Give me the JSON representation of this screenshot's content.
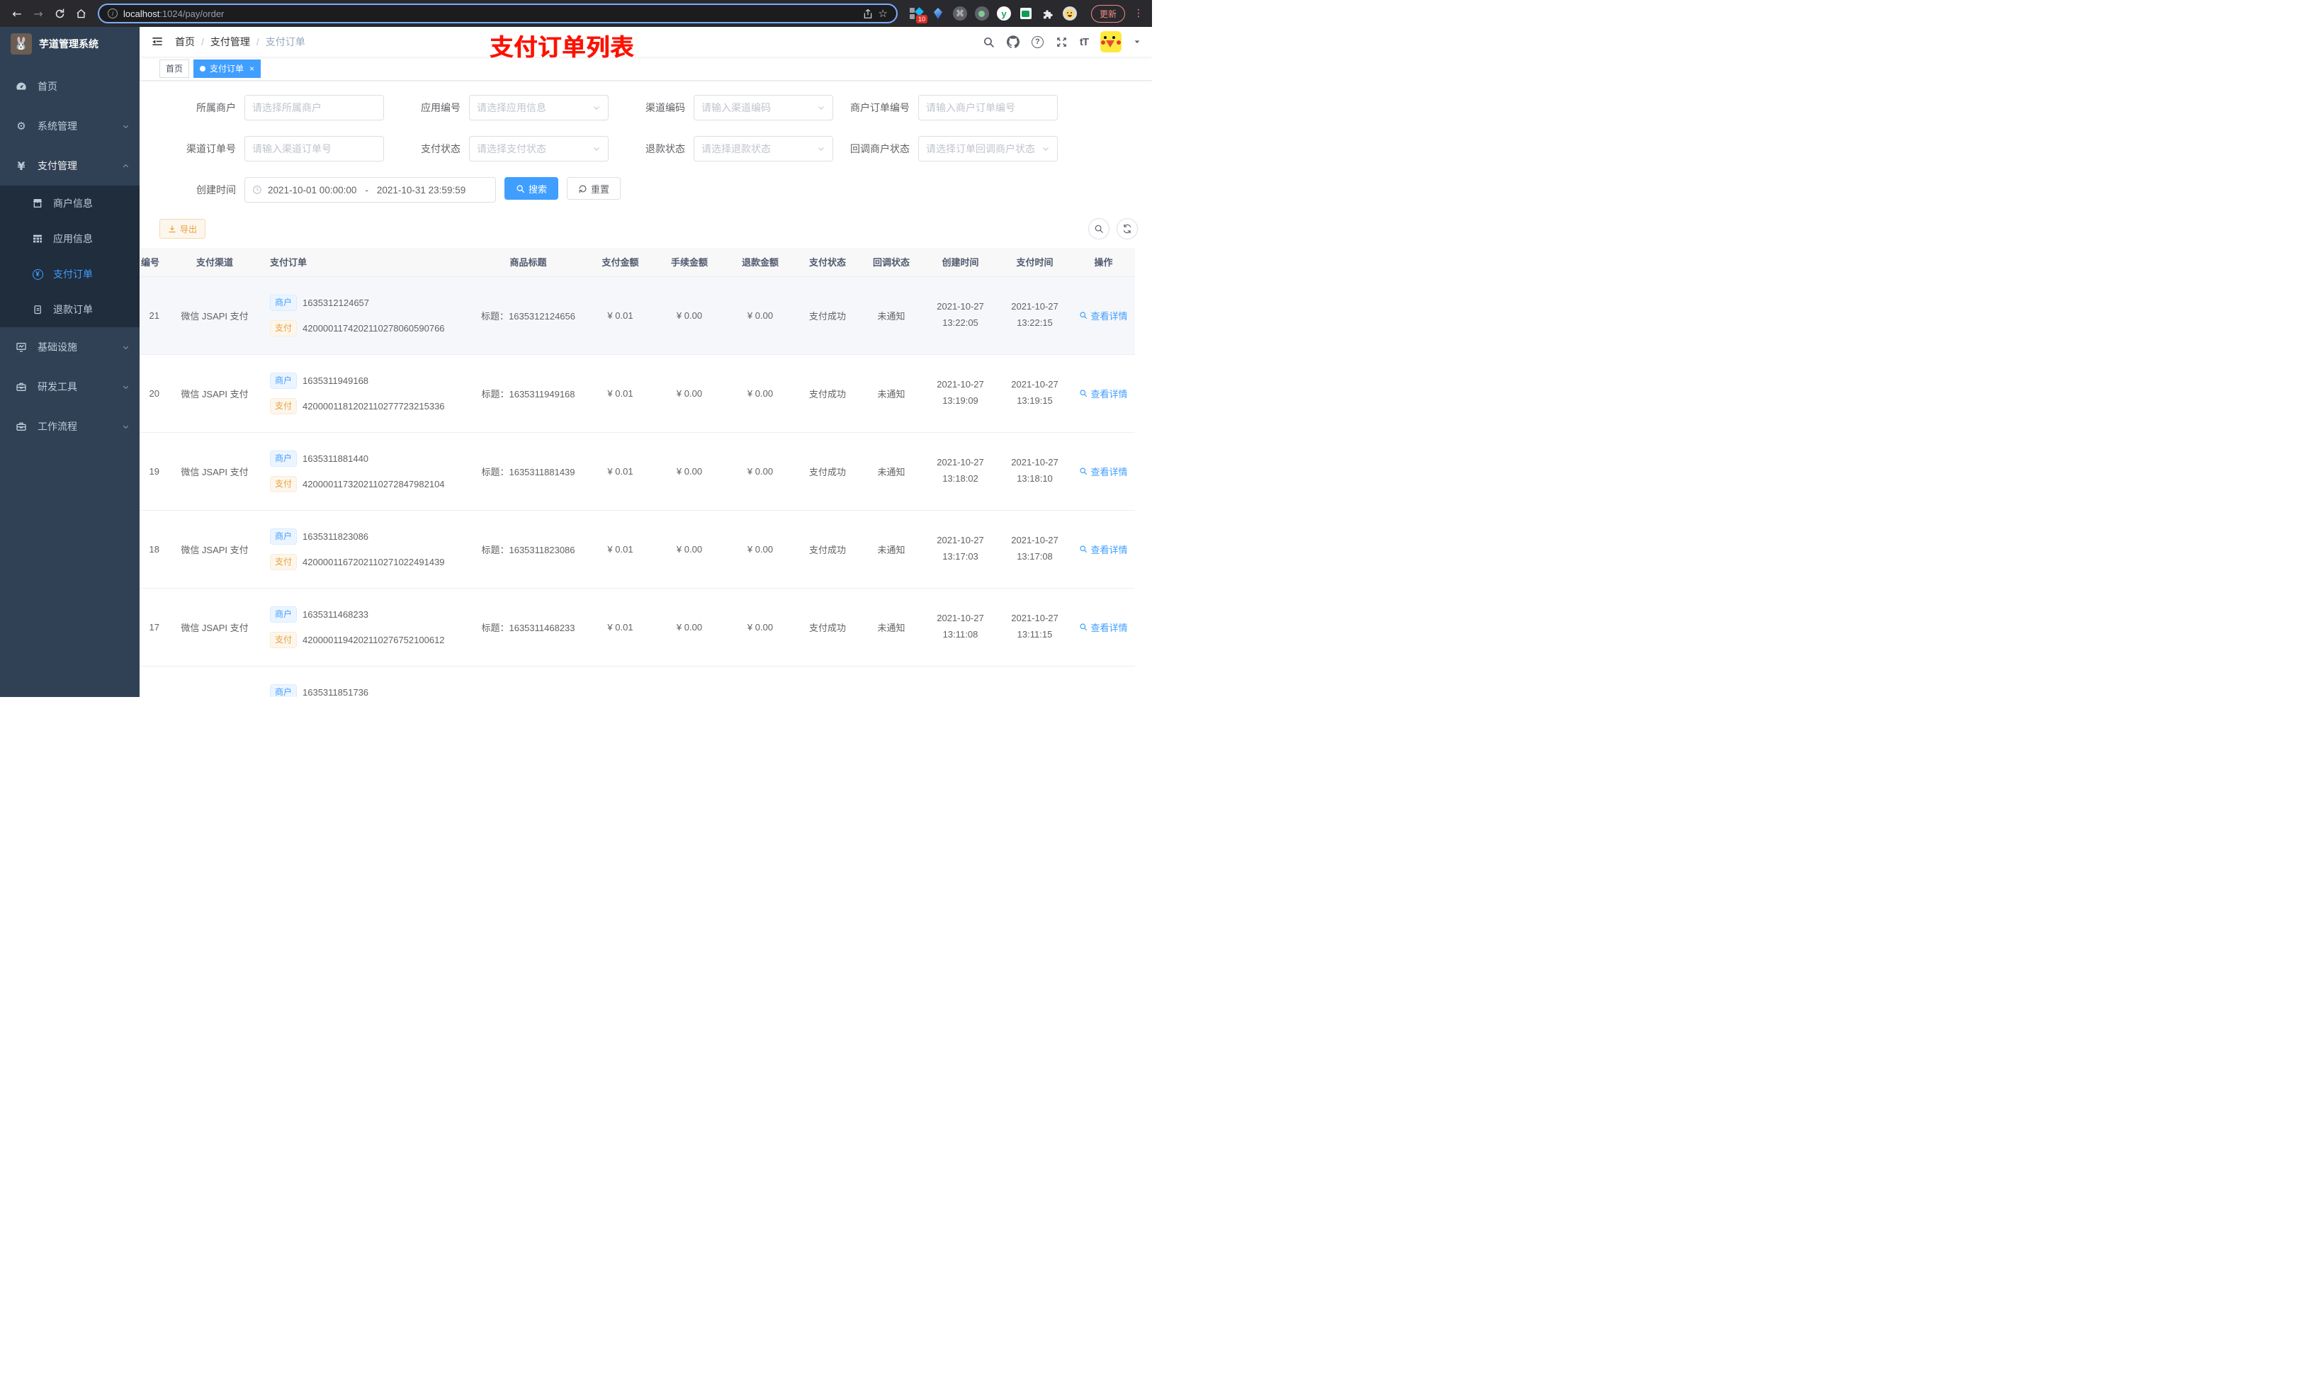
{
  "colors": {
    "primary": "#409eff",
    "warning": "#e6a23c",
    "sidebar_bg": "#304156",
    "submenu_bg": "#1f2d3d",
    "annotation_red": "#fe1100",
    "chrome_bg": "#2a2a2e"
  },
  "browser": {
    "url_host": "localhost",
    "url_path": ":1024/pay/order",
    "info_glyph": "i",
    "ext_badge": "10",
    "ext_y_glyph": "y",
    "cmd_glyph": "⌘",
    "update_label": "更新",
    "icons": [
      "back-icon",
      "forward-icon",
      "reload-icon",
      "home-icon",
      "share-icon",
      "star-icon",
      "extensions-puzzle-icon",
      "menu-dots-icon"
    ]
  },
  "sidebar": {
    "logo_title": "芋道管理系统",
    "logo_glyph": "🐰",
    "yen_glyph": "¥",
    "gear_glyph": "⚙",
    "items": [
      {
        "label": "首页"
      },
      {
        "label": "系统管理"
      },
      {
        "label": "支付管理"
      },
      {
        "label": "基础设施"
      },
      {
        "label": "研发工具"
      },
      {
        "label": "工作流程"
      }
    ],
    "sub": [
      {
        "label": "商户信息"
      },
      {
        "label": "应用信息"
      },
      {
        "label": "支付订单"
      },
      {
        "label": "退款订单"
      }
    ]
  },
  "header": {
    "breadcrumb": [
      "首页",
      "支付管理",
      "支付订单"
    ],
    "annotation_title": "支付订单列表",
    "help_glyph": "?",
    "font_icon_text": "tT",
    "icons": [
      "search-icon",
      "github-icon",
      "question-icon",
      "fullscreen-icon",
      "font-size-icon",
      "avatar",
      "caret-down-icon"
    ]
  },
  "tags_view": {
    "tabs": [
      {
        "label": "首页"
      },
      {
        "label": "支付订单",
        "close_glyph": "×"
      }
    ]
  },
  "filters": {
    "fields": [
      {
        "label": "所属商户",
        "placeholder": "请选择所属商户"
      },
      {
        "label": "应用编号",
        "placeholder": "请选择应用信息"
      },
      {
        "label": "渠道编码",
        "placeholder": "请输入渠道编码"
      },
      {
        "label": "商户订单编号",
        "placeholder": "请输入商户订单编号"
      },
      {
        "label": "渠道订单号",
        "placeholder": "请输入渠道订单号"
      },
      {
        "label": "支付状态",
        "placeholder": "请选择支付状态"
      },
      {
        "label": "退款状态",
        "placeholder": "请选择退款状态"
      },
      {
        "label": "回调商户状态",
        "placeholder": "请选择订单回调商户状态"
      }
    ],
    "date": {
      "label": "创建时间",
      "start": "2021-10-01 00:00:00",
      "separator": "-",
      "end": "2021-10-31 23:59:59"
    },
    "search_label": "搜索",
    "reset_label": "重置"
  },
  "toolbar": {
    "export_label": "导出"
  },
  "table": {
    "columns": [
      "编号",
      "支付渠道",
      "支付订单",
      "商品标题",
      "支付金额",
      "手续金额",
      "退款金额",
      "支付状态",
      "回调状态",
      "创建时间",
      "支付时间",
      "操作"
    ],
    "tag_merchant": "商户",
    "tag_pay": "支付",
    "action_label": "查看详情",
    "rows": [
      {
        "hover": true,
        "id": "21",
        "channel": "微信 JSAPI 支付",
        "merchant_no": "1635312124657",
        "pay_no": "4200001174202110278060590766",
        "title": "标题：1635312124656",
        "amount": "¥ 0.01",
        "fee": "¥ 0.00",
        "refund": "¥ 0.00",
        "status": "支付成功",
        "notify": "未通知",
        "created_date": "2021-10-27",
        "created_time": "13:22:05",
        "paid_date": "2021-10-27",
        "paid_time": "13:22:15"
      },
      {
        "id": "20",
        "channel": "微信 JSAPI 支付",
        "merchant_no": "1635311949168",
        "pay_no": "4200001181202110277723215336",
        "title": "标题：1635311949168",
        "amount": "¥ 0.01",
        "fee": "¥ 0.00",
        "refund": "¥ 0.00",
        "status": "支付成功",
        "notify": "未通知",
        "created_date": "2021-10-27",
        "created_time": "13:19:09",
        "paid_date": "2021-10-27",
        "paid_time": "13:19:15"
      },
      {
        "id": "19",
        "channel": "微信 JSAPI 支付",
        "merchant_no": "1635311881440",
        "pay_no": "4200001173202110272847982104",
        "title": "标题：1635311881439",
        "amount": "¥ 0.01",
        "fee": "¥ 0.00",
        "refund": "¥ 0.00",
        "status": "支付成功",
        "notify": "未通知",
        "created_date": "2021-10-27",
        "created_time": "13:18:02",
        "paid_date": "2021-10-27",
        "paid_time": "13:18:10"
      },
      {
        "id": "18",
        "channel": "微信 JSAPI 支付",
        "merchant_no": "1635311823086",
        "pay_no": "4200001167202110271022491439",
        "title": "标题：1635311823086",
        "amount": "¥ 0.01",
        "fee": "¥ 0.00",
        "refund": "¥ 0.00",
        "status": "支付成功",
        "notify": "未通知",
        "created_date": "2021-10-27",
        "created_time": "13:17:03",
        "paid_date": "2021-10-27",
        "paid_time": "13:17:08"
      },
      {
        "id": "17",
        "channel": "微信 JSAPI 支付",
        "merchant_no": "1635311468233",
        "pay_no": "4200001194202110276752100612",
        "title": "标题：1635311468233",
        "amount": "¥ 0.01",
        "fee": "¥ 0.00",
        "refund": "¥ 0.00",
        "status": "支付成功",
        "notify": "未通知",
        "created_date": "2021-10-27",
        "created_time": "13:11:08",
        "paid_date": "2021-10-27",
        "paid_time": "13:11:15"
      },
      {
        "id": "",
        "channel": "",
        "merchant_no": "1635311851736",
        "pay_no": "",
        "title": "",
        "amount": "",
        "fee": "",
        "refund": "",
        "status": "",
        "notify": "",
        "created_date": "",
        "created_time": "",
        "paid_date": "",
        "paid_time": ""
      }
    ]
  }
}
